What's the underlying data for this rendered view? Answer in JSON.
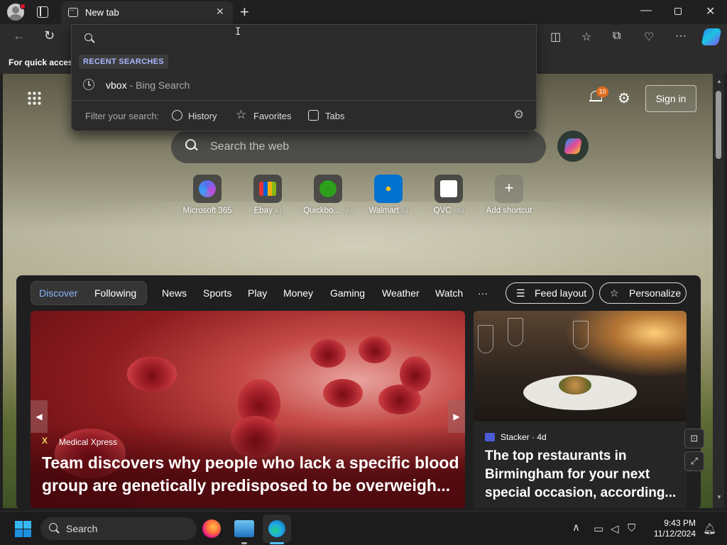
{
  "browser": {
    "tab_title": "New tab",
    "favorites_bar_text": "For quick access"
  },
  "address_dropdown": {
    "input_value": "",
    "recent_label": "RECENT SEARCHES",
    "recent_items": [
      {
        "term": "vbox",
        "source": " - Bing Search"
      }
    ],
    "filter_label": "Filter your search:",
    "filters": [
      "History",
      "Favorites",
      "Tabs"
    ]
  },
  "newtab": {
    "notification_count": "10",
    "sign_in": "Sign in",
    "search_placeholder": "Search the web",
    "shortcuts": [
      {
        "label": "Microsoft 365",
        "ad": ""
      },
      {
        "label": "Ebay",
        "ad": "Ad"
      },
      {
        "label": "Quickbo...",
        "ad": "Ad"
      },
      {
        "label": "Walmart",
        "ad": "Ad"
      },
      {
        "label": "QVC",
        "ad": "Ad"
      },
      {
        "label": "Add shortcut",
        "ad": ""
      }
    ]
  },
  "feed": {
    "nav": [
      "Discover",
      "Following",
      "News",
      "Sports",
      "Play",
      "Money",
      "Gaming",
      "Weather",
      "Watch",
      "···"
    ],
    "feed_layout": "Feed layout",
    "personalize": "Personalize",
    "main_card": {
      "source": "Medical Xpress",
      "headline": "Team discovers why people who lack a specific blood group are genetically predisposed to be overweigh..."
    },
    "side_card": {
      "source": "Stacker · 4d",
      "headline": "The top restaurants in Birmingham for your next special occasion, according..."
    }
  },
  "taskbar": {
    "search_label": "Search",
    "time": "9:43 PM",
    "date": "11/12/2024"
  },
  "colors": {
    "accent_link": "#8ab4f8",
    "badge": "#e06c1f",
    "windows_blue": "#1e90e0"
  }
}
